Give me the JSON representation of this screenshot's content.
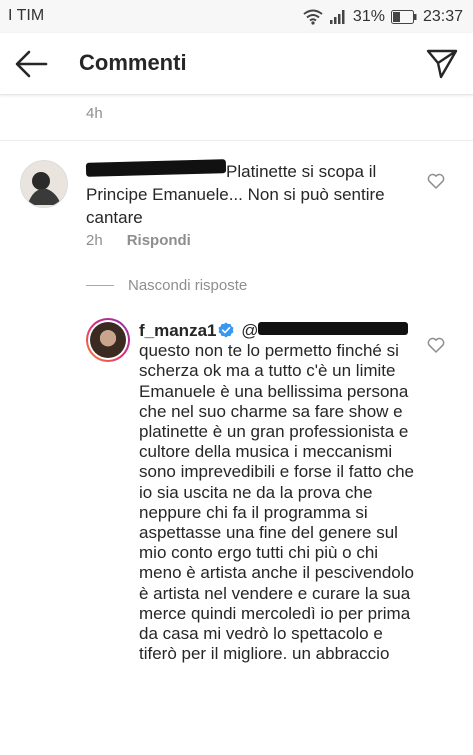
{
  "status_bar": {
    "carrier": "I TIM",
    "battery": "31%",
    "time": "23:37"
  },
  "header": {
    "title": "Commenti"
  },
  "top_time": "4h",
  "comment": {
    "text": "Platinette si scopa il Principe Emanuele... Non si può sentire cantare",
    "time": "2h",
    "reply_label": "Rispondi"
  },
  "hide_replies_label": "Nascondi risposte",
  "reply": {
    "username": "f_manza1",
    "handle_prefix": "@",
    "text": "questo non te lo permetto finché si scherza ok ma a  tutto c'è un limite Emanuele è una bellissima persona che nel suo charme sa fare show e platinette è un gran professionista e cultore della musica i meccanismi sono imprevedibili e forse il fatto che io sia uscita ne da la prova che neppure chi fa il programma si aspettasse una fine del genere sul mio conto ergo tutti chi più o chi meno è artista anche il pescivendolo è artista nel vendere e curare la sua merce quindi mercoledì io per prima da casa mi vedrò lo spettacolo e tiferò per il migliore. un abbraccio"
  },
  "colors": {
    "verified": "#3897f0",
    "muted_text": "#8e8e8e",
    "text": "#262626"
  }
}
